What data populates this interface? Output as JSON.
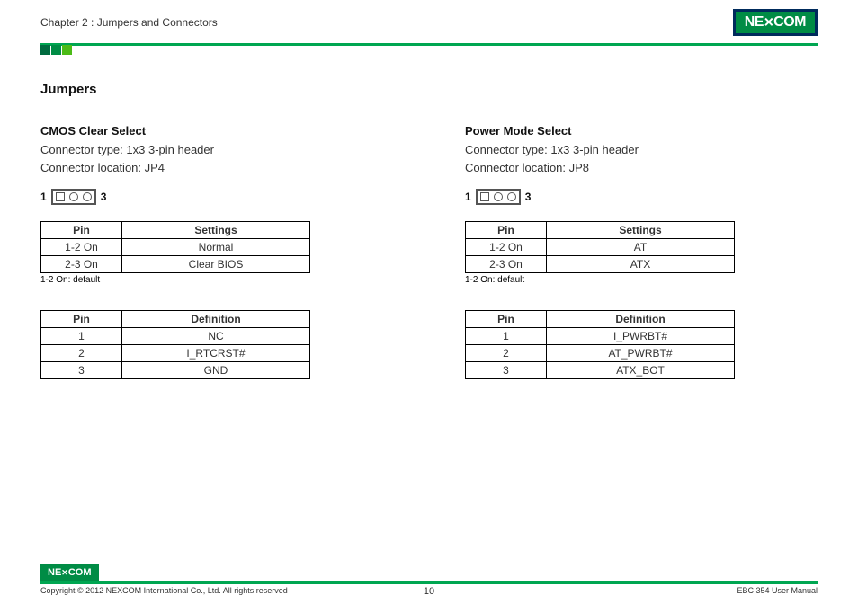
{
  "header": {
    "chapter": "Chapter 2 : Jumpers and Connectors",
    "logo_text": "NE COM"
  },
  "section_heading": "Jumpers",
  "left": {
    "title": "CMOS Clear Select",
    "conn_type_label": "Connector type: ",
    "conn_type": "1x3 3-pin header",
    "conn_loc_label": "Connector location: ",
    "conn_loc": "JP4",
    "diagram": {
      "left_pin": "1",
      "right_pin": "3"
    },
    "settings_table": {
      "headers": [
        "Pin",
        "Settings"
      ],
      "rows": [
        [
          "1-2 On",
          "Normal"
        ],
        [
          "2-3 On",
          "Clear BIOS"
        ]
      ],
      "note": "1-2 On: default"
    },
    "def_table": {
      "headers": [
        "Pin",
        "Definition"
      ],
      "rows": [
        [
          "1",
          "NC"
        ],
        [
          "2",
          "I_RTCRST#"
        ],
        [
          "3",
          "GND"
        ]
      ]
    }
  },
  "right": {
    "title": "Power Mode Select",
    "conn_type_label": "Connector type: ",
    "conn_type": "1x3 3-pin header",
    "conn_loc_label": "Connector location: ",
    "conn_loc": "JP8",
    "diagram": {
      "left_pin": "1",
      "right_pin": "3"
    },
    "settings_table": {
      "headers": [
        "Pin",
        "Settings"
      ],
      "rows": [
        [
          "1-2 On",
          "AT"
        ],
        [
          "2-3 On",
          "ATX"
        ]
      ],
      "note": "1-2 On: default"
    },
    "def_table": {
      "headers": [
        "Pin",
        "Definition"
      ],
      "rows": [
        [
          "1",
          "I_PWRBT#"
        ],
        [
          "2",
          "AT_PWRBT#"
        ],
        [
          "3",
          "ATX_BOT"
        ]
      ]
    }
  },
  "footer": {
    "logo_text": "NE COM",
    "copyright": "Copyright © 2012 NEXCOM International Co., Ltd. All rights reserved",
    "page": "10",
    "doc": "EBC 354 User Manual"
  }
}
